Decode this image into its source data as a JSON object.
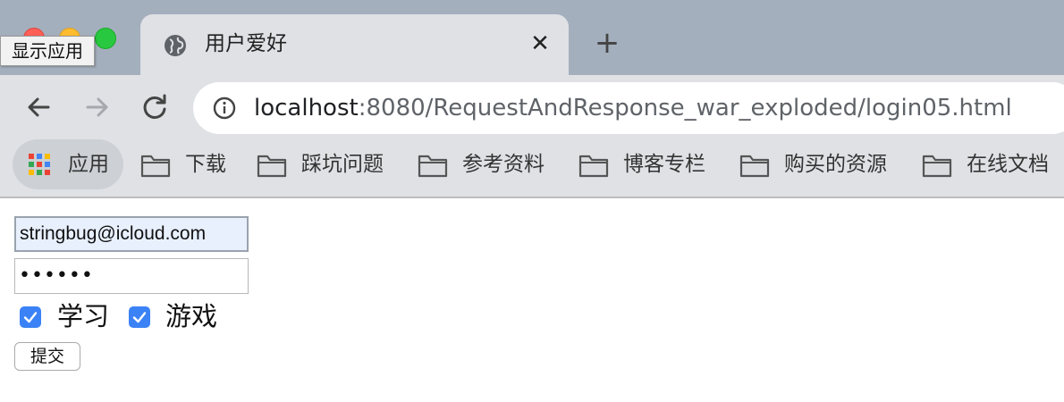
{
  "window": {
    "tooltip": "显示应用"
  },
  "tab": {
    "title": "用户爱好",
    "close_glyph": "✕",
    "new_tab_glyph": "+"
  },
  "toolbar": {
    "url_host": "localhost",
    "url_rest": ":8080/RequestAndResponse_war_exploded/login05.html"
  },
  "bookmarks": {
    "apps_label": "应用",
    "items": [
      "下载",
      "踩坑问题",
      "参考资料",
      "博客专栏",
      "购买的资源",
      "在线文档"
    ]
  },
  "form": {
    "email_value": "stringbug@icloud.com",
    "password_mask": "••••••",
    "hobbies": [
      {
        "label": "学习",
        "checked": true
      },
      {
        "label": "游戏",
        "checked": true
      }
    ],
    "submit_label": "提交"
  },
  "colors": {
    "accent": "#3b82f6",
    "tab_strip": "#a4afbd",
    "toolbar": "#dfe1e5"
  },
  "icons": {
    "tab_favicon": "globe-icon",
    "back": "arrow-left-icon",
    "forward": "arrow-right-icon",
    "reload": "reload-icon",
    "site_info": "info-icon",
    "apps": "apps-grid-icon",
    "bookmark_folder": "folder-icon"
  }
}
